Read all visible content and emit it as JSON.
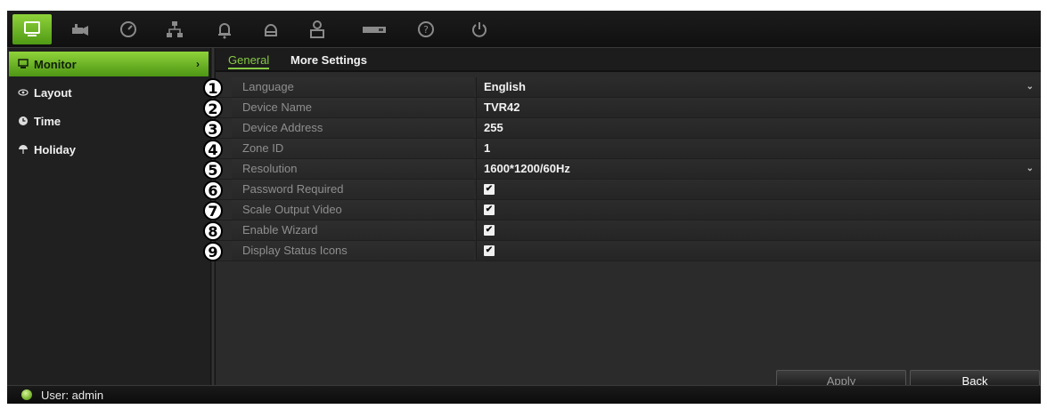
{
  "topbar": {
    "icons": [
      "display-icon",
      "camera-icon",
      "gauge-icon",
      "network-icon",
      "bell-icon",
      "disk-icon",
      "user-icon",
      "device-icon",
      "help-icon",
      "power-icon"
    ],
    "active_icon": "display-icon"
  },
  "sidebar": {
    "items": [
      {
        "label": "Monitor",
        "icon": "monitor-icon",
        "active": true,
        "chevron": "›"
      },
      {
        "label": "Layout",
        "icon": "layout-icon",
        "active": false
      },
      {
        "label": "Time",
        "icon": "clock-icon",
        "active": false
      },
      {
        "label": "Holiday",
        "icon": "holiday-icon",
        "active": false
      }
    ]
  },
  "tabs": [
    {
      "label": "General",
      "active": true
    },
    {
      "label": "More Settings",
      "active": false
    }
  ],
  "settings": [
    {
      "num": "1",
      "label": "Language",
      "value": "English",
      "dropdown": true
    },
    {
      "num": "2",
      "label": "Device Name",
      "value": "TVR42"
    },
    {
      "num": "3",
      "label": "Device Address",
      "value": "255"
    },
    {
      "num": "4",
      "label": "Zone ID",
      "value": "1"
    },
    {
      "num": "5",
      "label": "Resolution",
      "value": "1600*1200/60Hz",
      "dropdown": true
    },
    {
      "num": "6",
      "label": "Password Required",
      "checked": true
    },
    {
      "num": "7",
      "label": "Scale Output Video",
      "checked": true
    },
    {
      "num": "8",
      "label": "Enable Wizard",
      "checked": true
    },
    {
      "num": "9",
      "label": "Display Status Icons",
      "checked": true
    }
  ],
  "buttons": {
    "apply": "Apply",
    "back": "Back"
  },
  "status": {
    "user": "User: admin"
  },
  "colors": {
    "accent": "#86c943",
    "background": "#2a2a2a"
  }
}
